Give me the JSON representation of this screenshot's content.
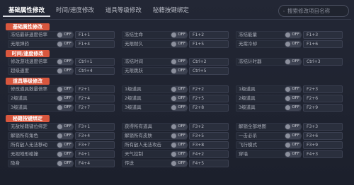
{
  "nav": {
    "tabs": [
      {
        "label": "基础属性修改"
      },
      {
        "label": "时间/速度修改"
      },
      {
        "label": "道具等级修改"
      },
      {
        "label": "秘籍按键绑定"
      }
    ],
    "search_placeholder": "搜索修改项目名称"
  },
  "sections": [
    {
      "label": "基础属性修改"
    },
    {
      "label": "时间/速度修改"
    },
    {
      "label": "道具等级修改"
    },
    {
      "label": "秘籍按键绑定"
    }
  ],
  "rows": [
    [
      {
        "label": "冻结最新速度倍率",
        "toggle": "OFF",
        "hotkey": "F1+1"
      },
      {
        "label": "冻结生命",
        "toggle": "OFF",
        "hotkey": "F1+2"
      },
      {
        "label": "冻结能量",
        "toggle": "OFF",
        "hotkey": "F1+3"
      }
    ],
    [
      {
        "label": "无限弹药",
        "toggle": "OFF",
        "hotkey": "F1+4"
      },
      {
        "label": "无限耐久",
        "toggle": "OFF",
        "hotkey": "F1+5"
      },
      {
        "label": "无需冷却",
        "toggle": "OFF",
        "hotkey": "F1+6"
      }
    ],
    [
      {
        "label": "修改游戏速度倍率",
        "toggle": "OFF",
        "hotkey": "Ctrl+1"
      },
      {
        "label": "冻结时间",
        "toggle": "OFF",
        "hotkey": "Ctrl+2"
      },
      {
        "label": "冻结计时器",
        "toggle": "OFF",
        "hotkey": "Ctrl+3"
      }
    ],
    [
      {
        "label": "超级速度",
        "toggle": "OFF",
        "hotkey": "Ctrl+4"
      },
      {
        "label": "无限跳跃",
        "toggle": "OFF",
        "hotkey": "Ctrl+5"
      },
      {
        "label": "",
        "toggle": "",
        "hotkey": ""
      }
    ],
    [
      {
        "label": "修改道具数量倍率",
        "toggle": "OFF",
        "hotkey": "F2+1"
      },
      {
        "label": "1级道具",
        "toggle": "OFF",
        "hotkey": "F2+2"
      },
      {
        "label": "1级道具",
        "toggle": "OFF",
        "hotkey": "F2+3"
      }
    ],
    [
      {
        "label": "2级道具",
        "toggle": "OFF",
        "hotkey": "F2+4"
      },
      {
        "label": "2级道具",
        "toggle": "OFF",
        "hotkey": "F2+5"
      },
      {
        "label": "2级道具",
        "toggle": "OFF",
        "hotkey": "F2+6"
      }
    ],
    [
      {
        "label": "3级道具",
        "toggle": "OFF",
        "hotkey": "F2+7"
      },
      {
        "label": "3级道具",
        "toggle": "OFF",
        "hotkey": "F2+8"
      },
      {
        "label": "3级道具",
        "toggle": "OFF",
        "hotkey": "F2+9"
      }
    ],
    [
      {
        "label": "无敌秘籍键位绑定",
        "toggle": "OFF",
        "hotkey": "F3+1"
      },
      {
        "label": "获得所有道具",
        "toggle": "OFF",
        "hotkey": "F3+2"
      },
      {
        "label": "解锁全部地图",
        "toggle": "OFF",
        "hotkey": "F3+3"
      }
    ],
    [
      {
        "label": "解锁所有角色",
        "toggle": "OFF",
        "hotkey": "F3+4"
      },
      {
        "label": "解锁所有皮肤",
        "toggle": "OFF",
        "hotkey": "F3+5"
      },
      {
        "label": "一击必杀",
        "toggle": "OFF",
        "hotkey": "F3+6"
      }
    ],
    [
      {
        "label": "所有敌人无法移动",
        "toggle": "OFF",
        "hotkey": "F3+7"
      },
      {
        "label": "所有敌人无法攻击",
        "toggle": "OFF",
        "hotkey": "F3+8"
      },
      {
        "label": "飞行模式",
        "toggle": "OFF",
        "hotkey": "F3+9"
      }
    ],
    [
      {
        "label": "无视地形碰撞",
        "toggle": "OFF",
        "hotkey": "F4+1"
      },
      {
        "label": "天气控制",
        "toggle": "OFF",
        "hotkey": "F4+2"
      },
      {
        "label": "穿墙",
        "toggle": "OFF",
        "hotkey": "F4+3"
      }
    ],
    [
      {
        "label": "隐身",
        "toggle": "OFF",
        "hotkey": "F4+4"
      },
      {
        "label": "传送",
        "toggle": "OFF",
        "hotkey": "F4+5"
      },
      {
        "label": "",
        "toggle": "",
        "hotkey": ""
      }
    ]
  ]
}
